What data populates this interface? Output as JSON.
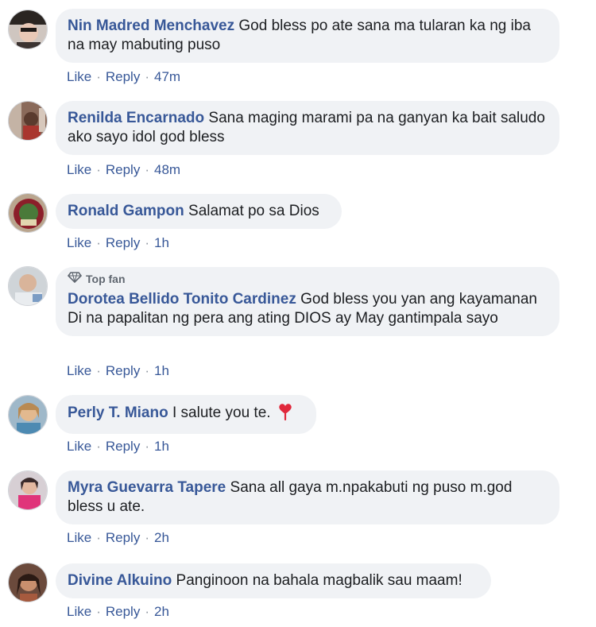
{
  "link_color": "#385898",
  "bubble_bg": "#f0f2f5",
  "comments": [
    {
      "author": "Nin Madred Menchavez",
      "text": "God bless po ate sana ma tularan ka ng iba na may mabuting puso",
      "like": "Like",
      "reply": "Reply",
      "time": "47m",
      "sep": "·"
    },
    {
      "author": "Renilda Encarnado",
      "text": "Sana maging marami pa na ganyan ka bait saludo ako sayo idol god bless",
      "like": "Like",
      "reply": "Reply",
      "time": "48m",
      "sep": "·"
    },
    {
      "author": "Ronald Gampon",
      "text": "Salamat po sa Dios",
      "like": "Like",
      "reply": "Reply",
      "time": "1h",
      "sep": "·"
    },
    {
      "badge": "Top fan",
      "author": "Dorotea Bellido Tonito Cardinez",
      "text": "God bless you yan ang kayamanan Di na papalitan ng pera ang ating DIOS ay May gantimpala sayo",
      "like": "Like",
      "reply": "Reply",
      "time": "1h",
      "sep": "·"
    },
    {
      "author": "Perly T. Miano",
      "text": "I salute you te.",
      "emoji": "heart-emoji",
      "like": "Like",
      "reply": "Reply",
      "time": "1h",
      "sep": "·"
    },
    {
      "author": "Myra Guevarra Tapere",
      "text": "Sana all gaya m.npakabuti ng puso m.god bless u ate.",
      "like": "Like",
      "reply": "Reply",
      "time": "2h",
      "sep": "·"
    },
    {
      "author": "Divine Alkuino",
      "text": "Panginoon na bahala magbalik sau maam!",
      "like": "Like",
      "reply": "Reply",
      "time": "2h",
      "sep": "·"
    }
  ]
}
